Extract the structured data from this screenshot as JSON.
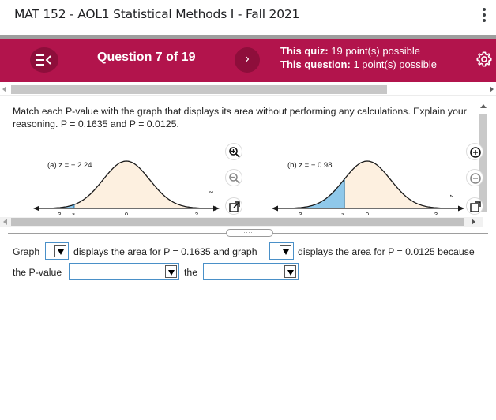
{
  "window": {
    "title": "MAT 152 - AOL1 Statistical Methods I - Fall 2021"
  },
  "header": {
    "question_label": "Question 7 of 19",
    "quiz_label": "This quiz:",
    "quiz_value": "19 point(s) possible",
    "question_points_label": "This question:",
    "question_points_value": "1 point(s) possible",
    "accent_color": "#b2144c"
  },
  "question": {
    "prompt_line1": "Match each P-value with the graph that displays its area without performing any calculations. Explain your",
    "prompt_line2": "reasoning. P = 0.1635 and P = 0.0125."
  },
  "graphs": [
    {
      "label": "(a) z = − 2.24",
      "z": -2.24,
      "ticks": [
        "−3",
        "z",
        "0",
        "3"
      ],
      "shade_color": "#8fc8ea",
      "fill_color": "#fdf0e0"
    },
    {
      "label": "(b) z = − 0.98",
      "z": -0.98,
      "ticks": [
        "−3",
        "z",
        "0",
        "3"
      ],
      "shade_color": "#8fc8ea",
      "fill_color": "#fdf0e0"
    }
  ],
  "tools": {
    "zoom_in": "zoom-in-icon",
    "zoom_out": "zoom-out-icon",
    "popout": "popout-icon",
    "z_glyph": "z"
  },
  "answer": {
    "text_graph": "Graph",
    "text_area1": "displays the area for P = 0.1635 and graph",
    "text_area2": "displays the area for P = 0.0125 because",
    "text_pvalue": "the P-value",
    "text_the": "the",
    "select1_value": "",
    "select2_value": "",
    "select3_value": "",
    "select4_value": ""
  },
  "divider": {
    "grip": "....."
  }
}
